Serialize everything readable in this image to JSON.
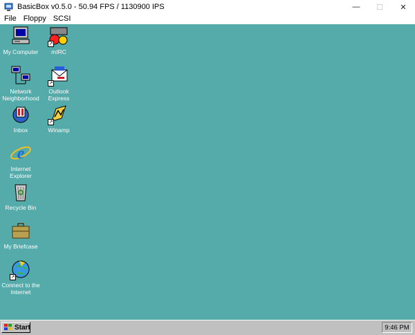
{
  "window": {
    "title": "BasicBox v0.5.0 - 50.94 FPS / 1130900 IPS",
    "minimize": "—",
    "maximize": "☐",
    "close": "✕"
  },
  "menu": [
    "File",
    "Floppy",
    "SCSI"
  ],
  "desktop": {
    "background": "#55aaaa",
    "icons": [
      {
        "label": "My Computer",
        "icon": "my-computer-icon"
      },
      {
        "label": "mIRC",
        "icon": "mirc-icon"
      },
      {
        "label": "Network\nNeighborhood",
        "icon": "network-neighborhood-icon"
      },
      {
        "label": "Outlook\nExpress",
        "icon": "outlook-express-icon"
      },
      {
        "label": "Inbox",
        "icon": "inbox-icon"
      },
      {
        "label": "Winamp",
        "icon": "winamp-icon"
      },
      {
        "label": "Internet\nExplorer",
        "icon": "internet-explorer-icon"
      },
      {
        "label": "Recycle Bin",
        "icon": "recycle-bin-icon"
      },
      {
        "label": "My Briefcase",
        "icon": "briefcase-icon"
      },
      {
        "label": "Connect to the\nInternet",
        "icon": "connect-internet-icon"
      }
    ]
  },
  "taskbar": {
    "start_label": "Start",
    "clock": "9:46 PM"
  }
}
